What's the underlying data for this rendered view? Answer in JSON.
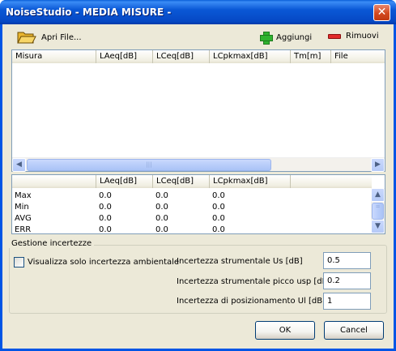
{
  "window": {
    "title": "NoiseStudio - MEDIA MISURE -",
    "close_glyph": "✕"
  },
  "toolbar": {
    "open_label": "Apri File...",
    "add_label": "Aggiungi",
    "remove_label": "Rimuovi",
    "icons": {
      "open": "folder-icon",
      "add": "plus-icon",
      "remove": "minus-icon"
    }
  },
  "measures_table": {
    "columns": [
      "Misura",
      "LAeq[dB]",
      "LCeq[dB]",
      "LCpkmax[dB]",
      "Tm[m]",
      "File"
    ],
    "rows": []
  },
  "stats_table": {
    "columns": [
      "",
      "LAeq[dB]",
      "LCeq[dB]",
      "LCpkmax[dB]",
      ""
    ],
    "rows": [
      [
        "Max",
        "0.0",
        "0.0",
        "0.0"
      ],
      [
        "Min",
        "0.0",
        "0.0",
        "0.0"
      ],
      [
        "AVG",
        "0.0",
        "0.0",
        "0.0"
      ],
      [
        "ERR",
        "0.0",
        "0.0",
        "0.0"
      ]
    ]
  },
  "uncertainty": {
    "group_title": "Gestione incertezze",
    "ambient_only_label": "Visualizza solo incertezza ambientale",
    "ambient_only_checked": false,
    "instrumental_label": "Incertezza strumentale Us [dB]",
    "instrumental_value": "0.5",
    "peak_label": "Incertezza strumentale picco usp [dB]",
    "peak_value": "0.2",
    "position_label": "Incertezza di posizionamento Ul [dB]",
    "position_value": "1"
  },
  "buttons": {
    "ok_label": "OK",
    "cancel_label": "Cancel"
  },
  "colors": {
    "titlebar": "#0055e5",
    "client_background": "#ece9d8",
    "add_icon": "#2fb32f",
    "remove_icon": "#e22a2a"
  }
}
